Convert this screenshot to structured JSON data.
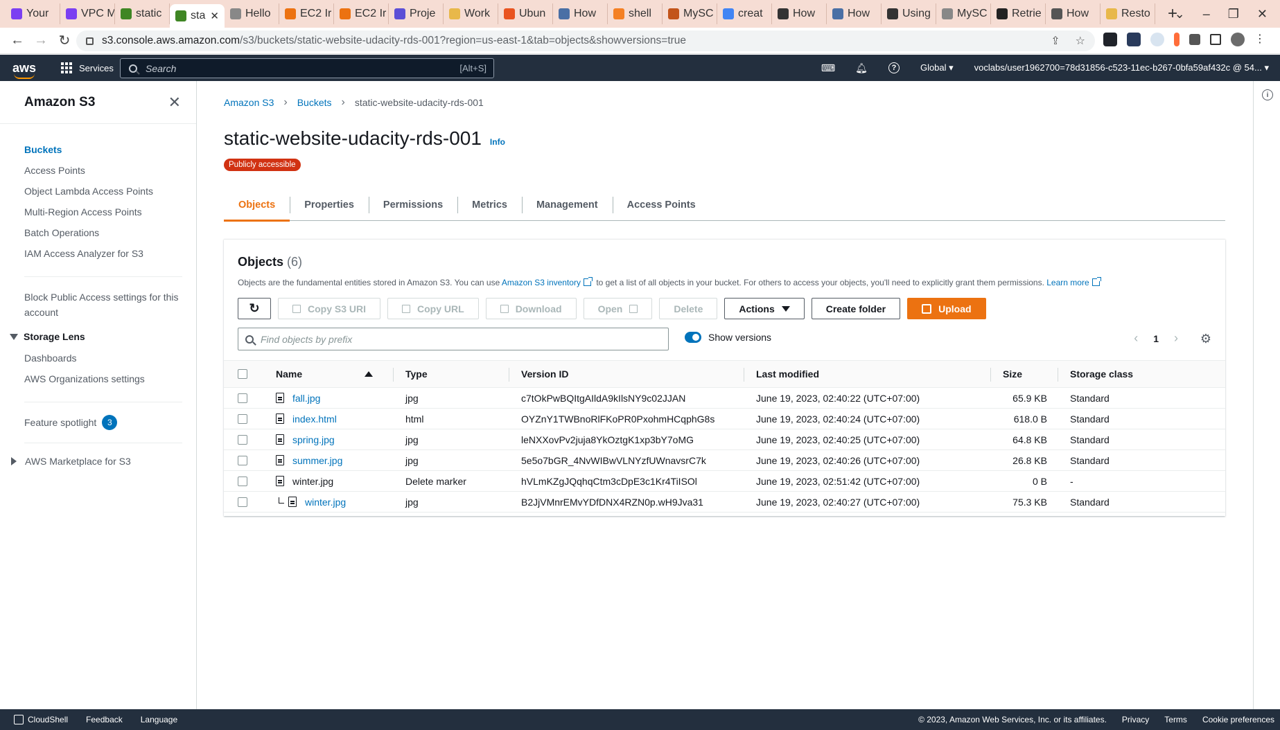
{
  "browser": {
    "tabs": [
      {
        "label": "Your",
        "color": "#7b3ff2"
      },
      {
        "label": "VPC M",
        "color": "#7b3ff2"
      },
      {
        "label": "static",
        "color": "#3f8624"
      },
      {
        "label": "sta",
        "color": "#3f8624",
        "active": true
      },
      {
        "label": "Hello",
        "color": "#888888"
      },
      {
        "label": "EC2 Ir",
        "color": "#ec7211"
      },
      {
        "label": "EC2 Ir",
        "color": "#ec7211"
      },
      {
        "label": "Proje",
        "color": "#5b4fd6"
      },
      {
        "label": "Work",
        "color": "#e8b84a"
      },
      {
        "label": "Ubun",
        "color": "#e95420"
      },
      {
        "label": "How",
        "color": "#4a6fa5"
      },
      {
        "label": "shell",
        "color": "#f48024"
      },
      {
        "label": "MySC",
        "color": "#c2541a"
      },
      {
        "label": "creat",
        "color": "#4285f4"
      },
      {
        "label": "How",
        "color": "#333333"
      },
      {
        "label": "How",
        "color": "#4a6fa5"
      },
      {
        "label": "Using",
        "color": "#333333"
      },
      {
        "label": "MySC",
        "color": "#888888"
      },
      {
        "label": "Retrie",
        "color": "#222222"
      },
      {
        "label": "How",
        "color": "#555555"
      },
      {
        "label": "Resto",
        "color": "#e8b84a"
      }
    ],
    "new_tab": "+",
    "url_host": "s3.console.aws.amazon.com",
    "url_path": "/s3/buckets/static-website-udacity-rds-001?region=us-east-1&tab=objects&showversions=true"
  },
  "awsnav": {
    "logo": "aws",
    "services": "Services",
    "search_placeholder": "Search",
    "search_hint": "[Alt+S]",
    "region": "Global ▾",
    "account": "voclabs/user1962700=78d31856-c523-11ec-b267-0bfa59af432c @ 54... ▾"
  },
  "sidebar": {
    "title": "Amazon S3",
    "items": [
      {
        "label": "Buckets",
        "active": true
      },
      {
        "label": "Access Points"
      },
      {
        "label": "Object Lambda Access Points"
      },
      {
        "label": "Multi-Region Access Points"
      },
      {
        "label": "Batch Operations"
      },
      {
        "label": "IAM Access Analyzer for S3"
      }
    ],
    "block_public": "Block Public Access settings for this account",
    "storage_lens": "Storage Lens",
    "storage_lens_items": [
      "Dashboards",
      "AWS Organizations settings"
    ],
    "feature_spotlight": "Feature spotlight",
    "feature_count": "3",
    "marketplace": "AWS Marketplace for S3"
  },
  "breadcrumb": {
    "items": [
      "Amazon S3",
      "Buckets",
      "static-website-udacity-rds-001"
    ]
  },
  "page": {
    "title": "static-website-udacity-rds-001",
    "info": "Info",
    "badge": "Publicly accessible",
    "tabs": [
      "Objects",
      "Properties",
      "Permissions",
      "Metrics",
      "Management",
      "Access Points"
    ]
  },
  "objects": {
    "title": "Objects",
    "count": "(6)",
    "desc_1": "Objects are the fundamental entities stored in Amazon S3. You can use ",
    "desc_link": "Amazon S3 inventory",
    "desc_2": " to get a list of all objects in your bucket. For others to access your objects, you'll need to explicitly grant them permissions. ",
    "learn_more": "Learn more",
    "buttons": {
      "copy_uri": "Copy S3 URI",
      "copy_url": "Copy URL",
      "download": "Download",
      "open": "Open",
      "delete": "Delete",
      "actions": "Actions",
      "create_folder": "Create folder",
      "upload": "Upload"
    },
    "filter_placeholder": "Find objects by prefix",
    "show_versions": "Show versions",
    "page": "1",
    "columns": [
      "Name",
      "Type",
      "Version ID",
      "Last modified",
      "Size",
      "Storage class"
    ],
    "rows": [
      {
        "name": "fall.jpg",
        "type": "jpg",
        "version": "c7tOkPwBQItgAIldA9kIlsNY9c02JJAN",
        "modified": "June 19, 2023, 02:40:22 (UTC+07:00)",
        "size": "65.9 KB",
        "class": "Standard",
        "link": true
      },
      {
        "name": "index.html",
        "type": "html",
        "version": "OYZnY1TWBnoRlFKoPR0PxohmHCqphG8s",
        "modified": "June 19, 2023, 02:40:24 (UTC+07:00)",
        "size": "618.0 B",
        "class": "Standard",
        "link": true
      },
      {
        "name": "spring.jpg",
        "type": "jpg",
        "version": "leNXXovPv2juja8YkOztgK1xp3bY7oMG",
        "modified": "June 19, 2023, 02:40:25 (UTC+07:00)",
        "size": "64.8 KB",
        "class": "Standard",
        "link": true
      },
      {
        "name": "summer.jpg",
        "type": "jpg",
        "version": "5e5o7bGR_4NvWIBwVLNYzfUWnavsrC7k",
        "modified": "June 19, 2023, 02:40:26 (UTC+07:00)",
        "size": "26.8 KB",
        "class": "Standard",
        "link": true
      },
      {
        "name": "winter.jpg",
        "type": "Delete marker",
        "version": "hVLmKZgJQqhqCtm3cDpE3c1Kr4TiISOl",
        "modified": "June 19, 2023, 02:51:42 (UTC+07:00)",
        "size": "0 B",
        "class": "-",
        "link": false
      },
      {
        "name": "winter.jpg",
        "type": "jpg",
        "version": "B2JjVMnrEMvYDfDNX4RZN0p.wH9Jva31",
        "modified": "June 19, 2023, 02:40:27 (UTC+07:00)",
        "size": "75.3 KB",
        "class": "Standard",
        "link": true,
        "child": true
      }
    ]
  },
  "footer": {
    "cloudshell": "CloudShell",
    "feedback": "Feedback",
    "language": "Language",
    "copyright": "© 2023, Amazon Web Services, Inc. or its affiliates.",
    "privacy": "Privacy",
    "terms": "Terms",
    "cookies": "Cookie preferences"
  },
  "colors": {
    "aws_nav": "#232f3e",
    "link": "#0073bb",
    "accent": "#ec7211",
    "danger_badge": "#d13212"
  }
}
